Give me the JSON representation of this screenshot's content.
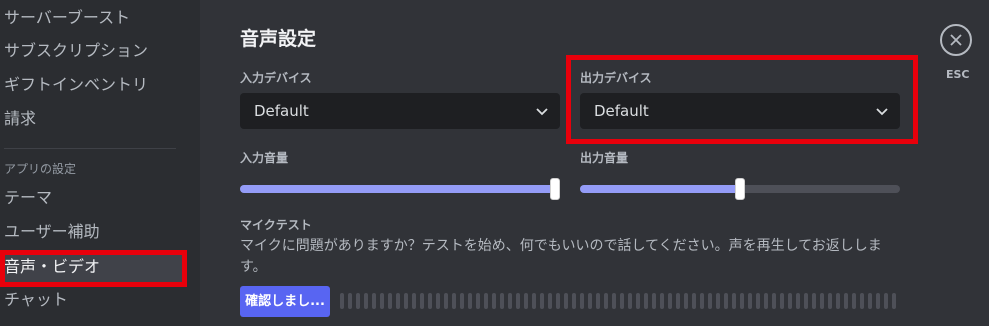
{
  "sidebar": {
    "items_top": [
      {
        "label": "サーバーブースト"
      },
      {
        "label": "サブスクリプション"
      },
      {
        "label": "ギフトインベントリ"
      },
      {
        "label": "請求"
      }
    ],
    "section_header": "アプリの設定",
    "items_app": [
      {
        "label": "テーマ"
      },
      {
        "label": "ユーザー補助"
      },
      {
        "label": "音声・ビデオ",
        "active": true
      },
      {
        "label": "チャット"
      }
    ]
  },
  "main": {
    "title": "音声設定",
    "input_device": {
      "label": "入力デバイス",
      "value": "Default"
    },
    "output_device": {
      "label": "出力デバイス",
      "value": "Default"
    },
    "input_volume": {
      "label": "入力音量",
      "percent": 100
    },
    "output_volume": {
      "label": "出力音量",
      "percent": 50
    },
    "mic_test": {
      "label": "マイクテスト",
      "description": "マイクに問題がありますか？テストを始め、何でもいいので話してください。声を再生してお返しします。",
      "button_label": "確認しまし..."
    }
  },
  "close": {
    "esc_label": "ESC"
  },
  "colors": {
    "highlight": "#e8000b",
    "accent": "#5865f2",
    "slider_fill": "#949cf7"
  }
}
